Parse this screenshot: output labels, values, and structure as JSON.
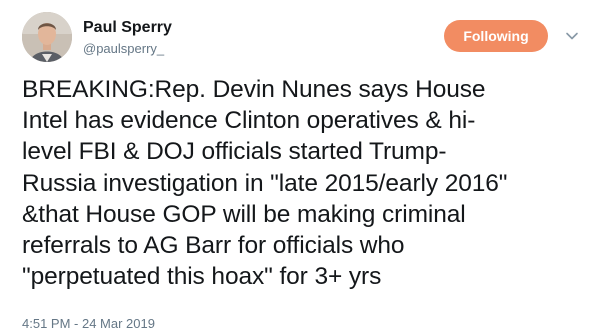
{
  "author": {
    "display_name": "Paul Sperry",
    "handle": "@paulsperry_",
    "avatar_icon": "user-avatar"
  },
  "follow_button": {
    "label": "Following",
    "color": "#f28c62"
  },
  "menu_icon": "chevron-down-icon",
  "tweet": {
    "text": "BREAKING:Rep. Devin Nunes says House\nIntel has evidence Clinton operatives & hi-\nlevel FBI & DOJ officials started Trump-\nRussia investigation in \"late 2015/early 2016\"\n&that House GOP will be making criminal\nreferrals to AG Barr for officials who\n\"perpetuated this hoax\" for 3+ yrs",
    "timestamp": "4:51 PM - 24 Mar 2019"
  }
}
